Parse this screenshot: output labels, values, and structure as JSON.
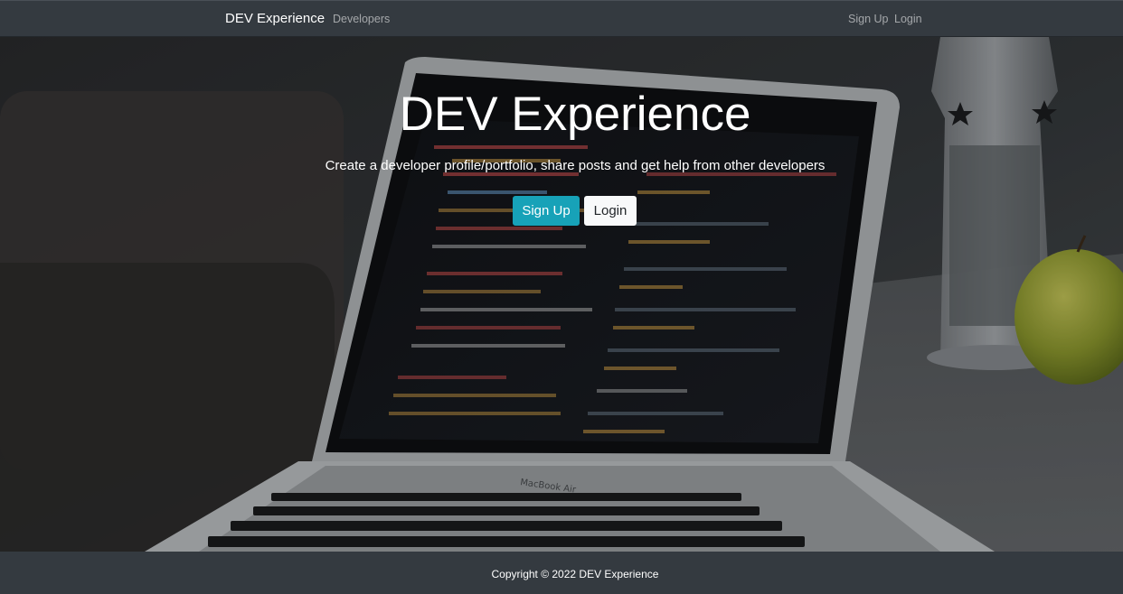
{
  "navbar": {
    "brand": "DEV Experience",
    "links": [
      {
        "label": "Developers"
      },
      {
        "label": "Sign Up"
      },
      {
        "label": "Login"
      }
    ]
  },
  "hero": {
    "title": "DEV Experience",
    "lead": "Create a developer profile/portfolio, share posts and get help from other developers",
    "buttons": {
      "signup": "Sign Up",
      "login": "Login"
    },
    "laptop_label": "MacBook Air"
  },
  "footer": {
    "copyright": "Copyright © 2022 DEV Experience"
  },
  "colors": {
    "navbar": "#343a40",
    "accent": "#17a2b8",
    "light_button": "#f8f9fa",
    "text": "#ffffff"
  }
}
